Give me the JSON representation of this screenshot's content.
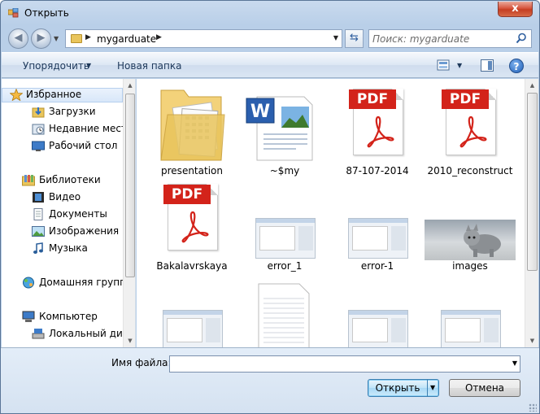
{
  "window": {
    "title": "Открыть",
    "close_label": "x"
  },
  "address": {
    "path": "mygarduate",
    "search_placeholder": "Поиск: mygarduate"
  },
  "toolbar": {
    "organize_label": "Упорядочить",
    "new_folder_label": "Новая папка",
    "help_label": "?"
  },
  "nav": {
    "favorites": {
      "label": "Избранное",
      "icon": "star-icon"
    },
    "favorite_items": [
      {
        "label": "Загрузки",
        "icon": "downloads-icon"
      },
      {
        "label": "Недавние места",
        "icon": "recent-places-icon"
      },
      {
        "label": "Рабочий стол",
        "icon": "desktop-icon"
      }
    ],
    "libraries": {
      "label": "Библиотеки",
      "icon": "libraries-icon"
    },
    "library_items": [
      {
        "label": "Видео",
        "icon": "video-icon"
      },
      {
        "label": "Документы",
        "icon": "documents-icon"
      },
      {
        "label": "Изображения",
        "icon": "pictures-icon"
      },
      {
        "label": "Музыка",
        "icon": "music-icon"
      }
    ],
    "homegroup": {
      "label": "Домашняя группа",
      "icon": "homegroup-icon"
    },
    "computer": {
      "label": "Компьютер",
      "icon": "computer-icon"
    },
    "computer_items": [
      {
        "label": "Локальный диск",
        "icon": "local-disk-icon"
      }
    ]
  },
  "files": [
    {
      "name": "presentation",
      "type": "folder"
    },
    {
      "name": "~$my",
      "type": "word"
    },
    {
      "name": "87-107-2014",
      "type": "pdf"
    },
    {
      "name": "2010_reconstruct",
      "type": "pdf"
    },
    {
      "name": "Bakalavrskaya",
      "type": "pdf"
    },
    {
      "name": "error_1",
      "type": "screenshot"
    },
    {
      "name": "error-1",
      "type": "screenshot"
    },
    {
      "name": "images",
      "type": "photo"
    }
  ],
  "pdf_badge": "PDF",
  "word_badge": "W",
  "bottom": {
    "filename_label": "Имя файла:",
    "filename_value": "",
    "open_label": "Открыть",
    "cancel_label": "Отмена"
  },
  "colors": {
    "pdf_red": "#d3231a",
    "folder_yellow": "#e9c55c",
    "accent_blue": "#3c7fb1"
  }
}
